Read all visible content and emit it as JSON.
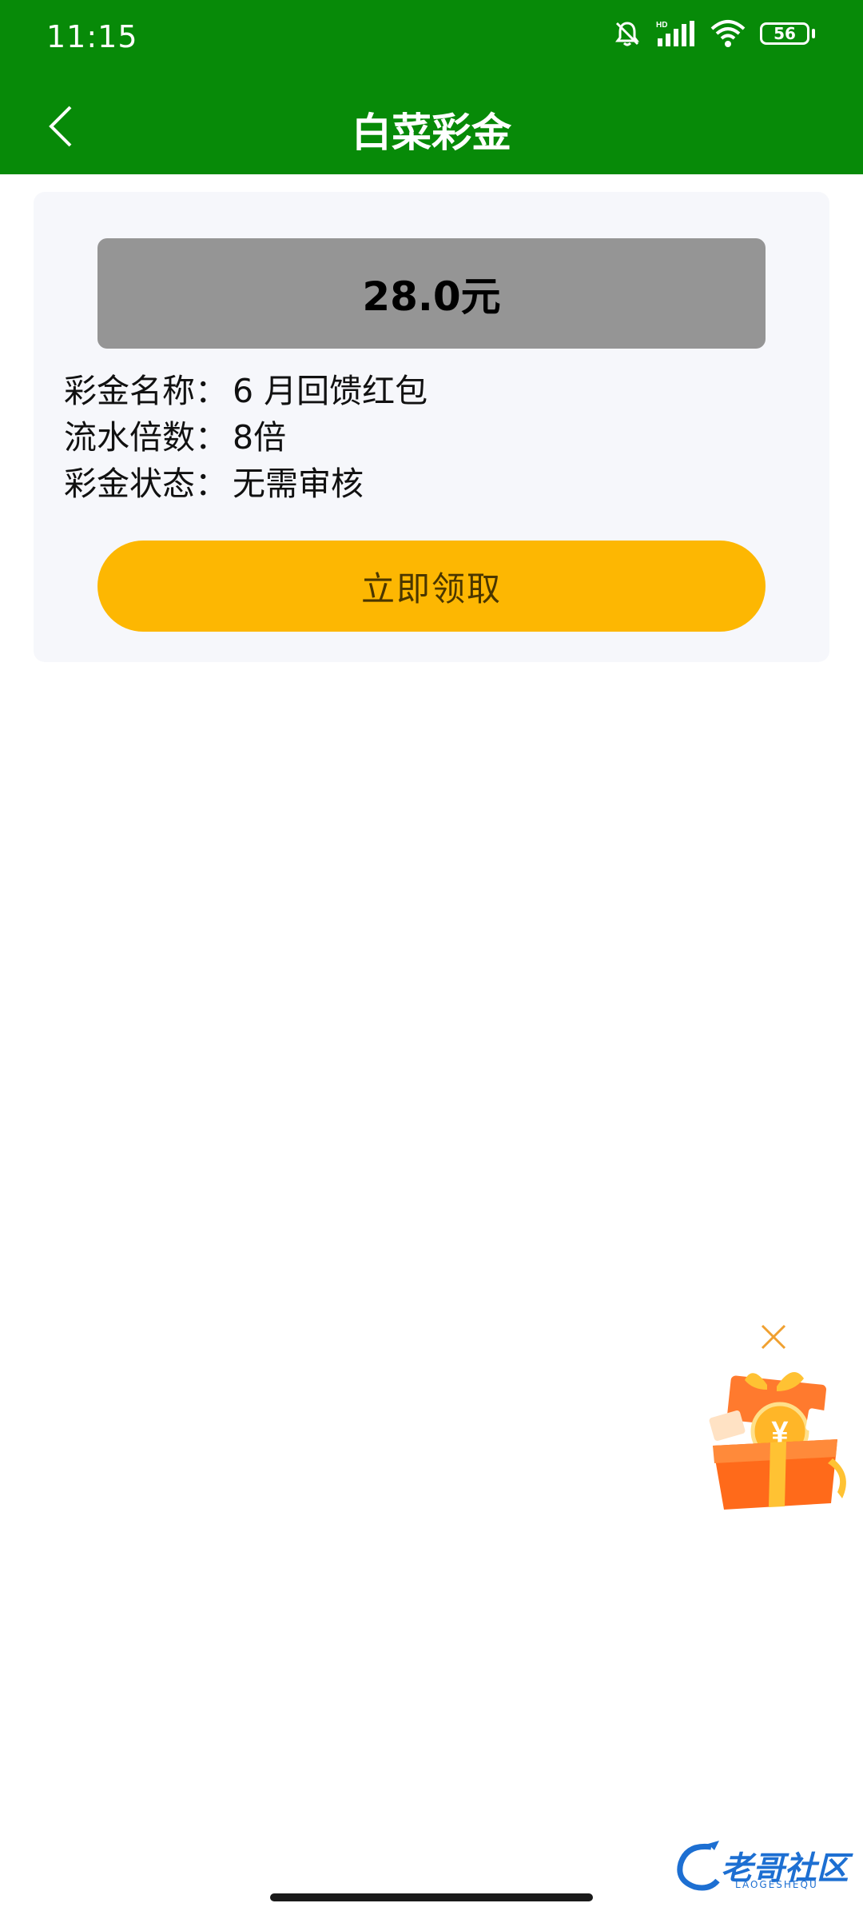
{
  "status_bar": {
    "time": "11:15",
    "battery": "56",
    "icons": [
      "bell-off-icon",
      "hd-signal-icon",
      "wifi-icon",
      "battery-icon"
    ]
  },
  "header": {
    "title": "白菜彩金",
    "back_icon": "chevron-left-icon"
  },
  "bonus": {
    "amount": "28.0元",
    "rows": [
      {
        "label": "彩金名称：",
        "value": "6 月回馈红包"
      },
      {
        "label": "流水倍数：",
        "value": "8倍"
      },
      {
        "label": "彩金状态：",
        "value": "无需审核"
      }
    ],
    "claim_label": "立即领取"
  },
  "floating_gift": {
    "close_icon": "close-icon",
    "icon": "gift-box-icon"
  },
  "watermark": {
    "text": "老哥社区",
    "sub": "LAOGESHEQU"
  },
  "colors": {
    "header_green": "#078a08",
    "card_bg": "#f6f7fb",
    "amount_bg": "#959595",
    "button_yellow": "#fdb702"
  }
}
